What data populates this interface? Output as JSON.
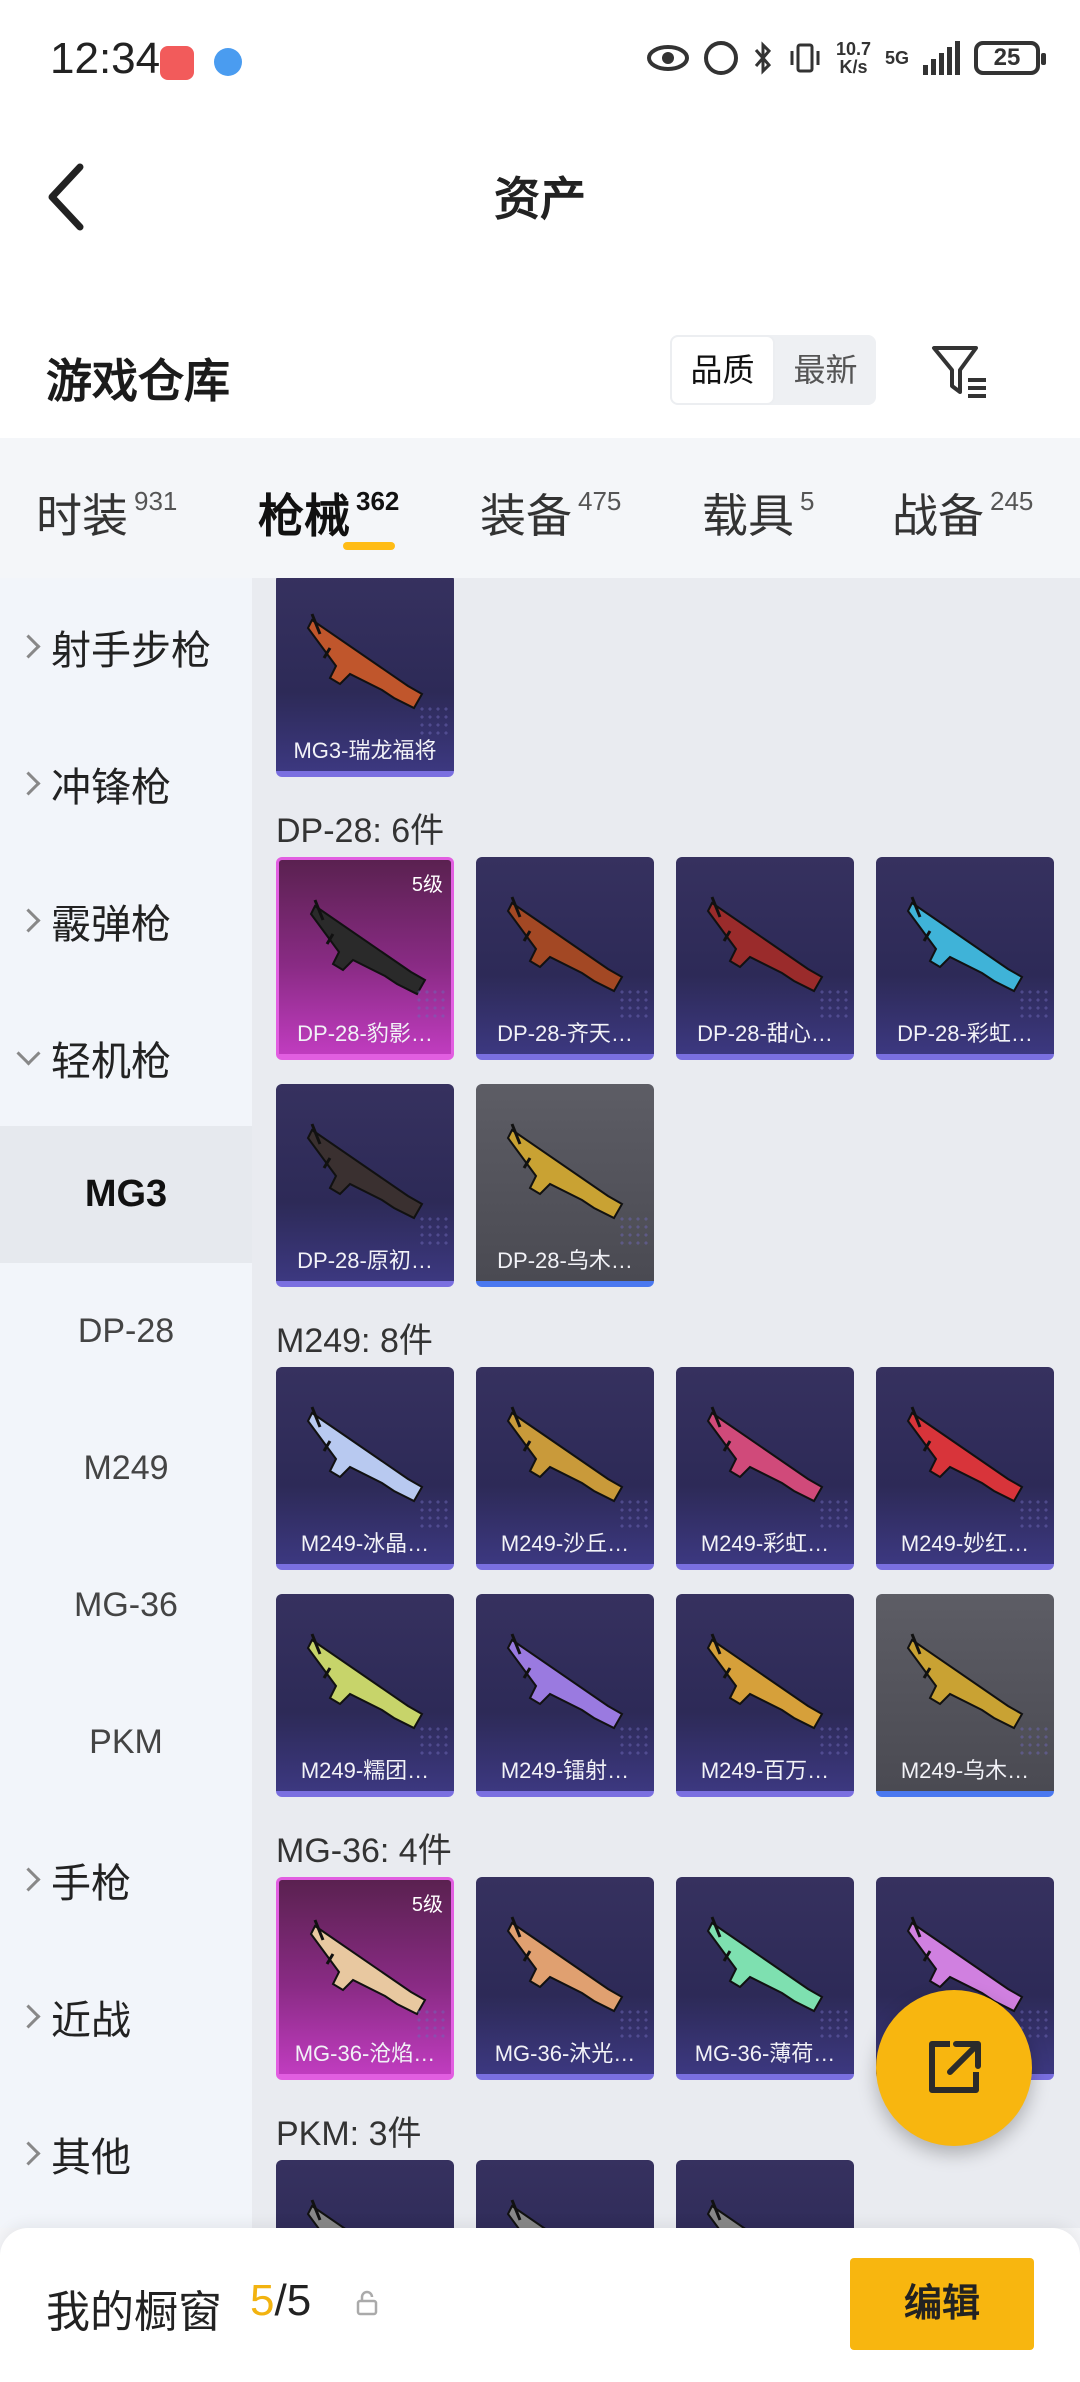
{
  "status_bar": {
    "time": "12:34",
    "net_speed_top": "10.7",
    "net_speed_bottom": "K/s",
    "network": "5G",
    "battery": "25"
  },
  "header": {
    "title": "资产"
  },
  "section": {
    "title": "游戏仓库",
    "sort_options": [
      "品质",
      "最新"
    ],
    "selected_sort": "品质"
  },
  "tabs": [
    {
      "label": "时装",
      "count": "931"
    },
    {
      "label": "枪械",
      "count": "362",
      "active": true
    },
    {
      "label": "装备",
      "count": "475"
    },
    {
      "label": "载具",
      "count": "5"
    },
    {
      "label": "战备",
      "count": "245"
    }
  ],
  "sidebar": {
    "categories": [
      "射手步枪",
      "冲锋枪",
      "霰弹枪",
      "轻机枪"
    ],
    "subs": [
      "MG3",
      "DP-28",
      "M249",
      "MG-36",
      "PKM"
    ],
    "more": [
      "手枪",
      "近战",
      "其他"
    ]
  },
  "groups": [
    {
      "title": "",
      "items": [
        {
          "name": "MG3-瑞龙福将",
          "style": "purple",
          "color": "#c0562c"
        }
      ]
    },
    {
      "title": "DP-28: 6件",
      "items": [
        {
          "name": "DP-28-豹影…",
          "style": "pink",
          "level": "5级",
          "color": "#2a2a2a"
        },
        {
          "name": "DP-28-齐天…",
          "style": "purple",
          "color": "#a34824"
        },
        {
          "name": "DP-28-甜心…",
          "style": "purple",
          "color": "#9a2b2b"
        },
        {
          "name": "DP-28-彩虹…",
          "style": "purple",
          "color": "#3fb3d8"
        },
        {
          "name": "DP-28-原初…",
          "style": "purple",
          "color": "#3a3030"
        },
        {
          "name": "DP-28-乌木…",
          "style": "gray",
          "color": "#c9a233"
        }
      ]
    },
    {
      "title": "M249: 8件",
      "items": [
        {
          "name": "M249-冰晶…",
          "style": "purple",
          "color": "#b8c9f0"
        },
        {
          "name": "M249-沙丘…",
          "style": "purple",
          "color": "#c99a3a"
        },
        {
          "name": "M249-彩虹…",
          "style": "purple",
          "color": "#d04a7a"
        },
        {
          "name": "M249-妙红…",
          "style": "purple",
          "color": "#d8343a"
        },
        {
          "name": "M249-糯团…",
          "style": "purple",
          "color": "#c7d46a"
        },
        {
          "name": "M249-镭射…",
          "style": "purple",
          "color": "#9a7ae0"
        },
        {
          "name": "M249-百万…",
          "style": "purple",
          "color": "#d6a03a"
        },
        {
          "name": "M249-乌木…",
          "style": "gray",
          "color": "#c9a233"
        }
      ]
    },
    {
      "title": "MG-36: 4件",
      "items": [
        {
          "name": "MG-36-沧焰…",
          "style": "pink",
          "level": "5级",
          "color": "#e8c8a0"
        },
        {
          "name": "MG-36-沐光…",
          "style": "purple",
          "color": "#e0a070"
        },
        {
          "name": "MG-36-薄荷…",
          "style": "purple",
          "color": "#7ee0b0"
        },
        {
          "name": "MG-36-…",
          "style": "purple",
          "color": "#d080e0"
        }
      ]
    },
    {
      "title": "PKM: 3件",
      "items": [
        {
          "name": "",
          "style": "purple",
          "color": "#888"
        },
        {
          "name": "",
          "style": "purple",
          "color": "#888"
        },
        {
          "name": "",
          "style": "purple",
          "color": "#888"
        }
      ]
    }
  ],
  "bottom": {
    "label": "我的橱窗",
    "current": "5",
    "total": "/5",
    "edit": "编辑"
  }
}
